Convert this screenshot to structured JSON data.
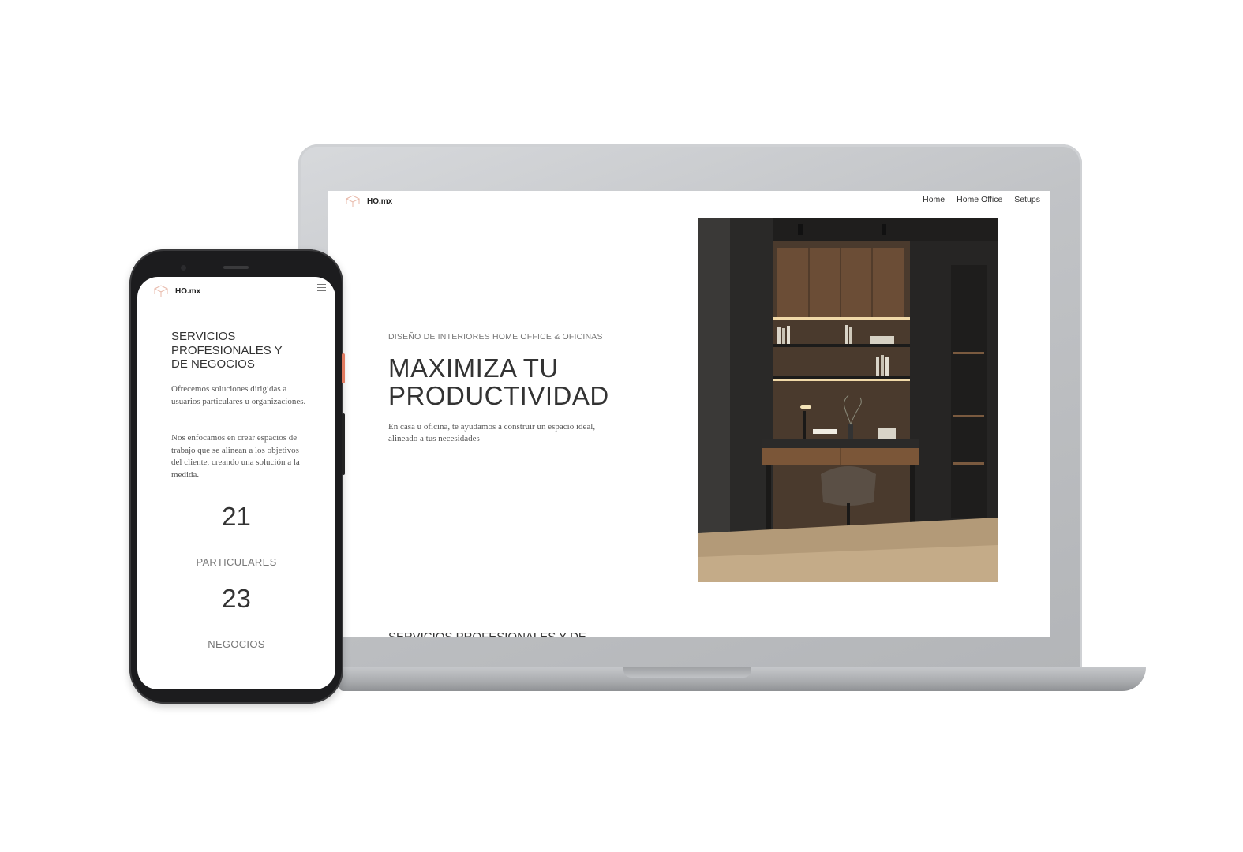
{
  "laptop": {
    "logo_text": "HO.mx",
    "nav": [
      "Home",
      "Home Office",
      "Setups"
    ],
    "hero": {
      "eyebrow": "DISEÑO DE INTERIORES HOME OFFICE & OFICINAS",
      "title_line1": "MAXIMIZA TU",
      "title_line2": "PRODUCTIVIDAD",
      "body_line1": "En casa u oficina, te ayudamos a construir un espacio ideal,",
      "body_line2": "alineado a tus necesidades"
    },
    "next_section_heading": "SERVICIOS PROFESIONALES Y DE"
  },
  "phone": {
    "logo_text": "HO.mx",
    "section": {
      "title_line1": "SERVICIOS",
      "title_line2": "PROFESIONALES Y",
      "title_line3": "DE NEGOCIOS",
      "p1": "Ofrecemos soluciones dirigidas a usuarios particulares u organizaciones.",
      "p2": "Nos enfocamos en crear espacios de trabajo que se alinean a los objetivos del cliente, creando una solución a la medida."
    },
    "stats": [
      {
        "value": "21",
        "label": "PARTICULARES"
      },
      {
        "value": "23",
        "label": "NEGOCIOS"
      }
    ]
  },
  "colors": {
    "accent": "#e07a5f",
    "text_dark": "#333333",
    "text_muted": "#777777"
  }
}
